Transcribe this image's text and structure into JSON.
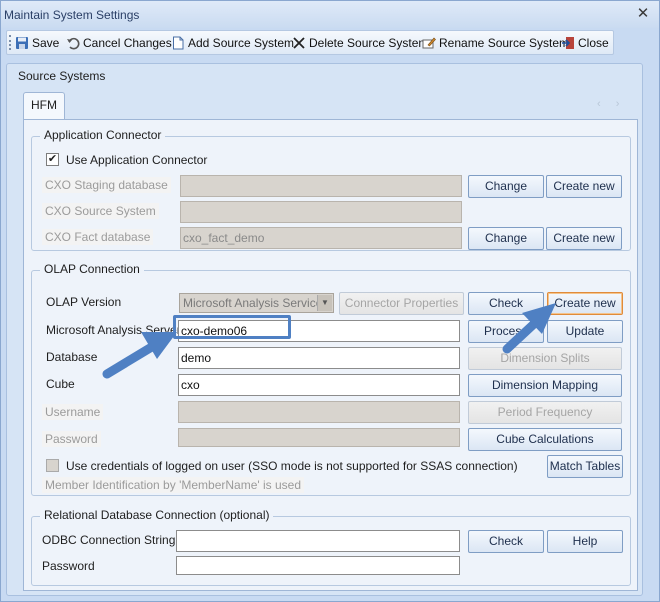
{
  "window": {
    "title": "Maintain System Settings",
    "close_glyph": "✕"
  },
  "toolbar": {
    "items": [
      {
        "label": "Save",
        "icon": "save-icon"
      },
      {
        "label": "Cancel Changes",
        "icon": "undo-icon"
      },
      {
        "label": "Add Source System",
        "icon": "new-document-icon"
      },
      {
        "label": "Delete Source System",
        "icon": "delete-icon"
      },
      {
        "label": "Rename Source System",
        "icon": "rename-icon"
      },
      {
        "label": "Close",
        "icon": "exit-icon"
      }
    ]
  },
  "source_systems": {
    "title": "Source Systems",
    "tabs": [
      {
        "label": "HFM",
        "selected": true
      }
    ],
    "tab_nav_glyph": "‹ ›"
  },
  "app_connector": {
    "title": "Application Connector",
    "use_connector": {
      "label": "Use Application Connector",
      "checked": true
    },
    "staging_db": {
      "label": "CXO Staging database",
      "value": "",
      "change": "Change",
      "create": "Create new"
    },
    "source_system": {
      "label": "CXO Source System",
      "value": ""
    },
    "fact_db": {
      "label": "CXO Fact database",
      "value": "cxo_fact_demo",
      "change": "Change",
      "create": "Create new"
    }
  },
  "olap": {
    "title": "OLAP Connection",
    "version": {
      "label": "OLAP Version",
      "selected": "Microsoft Analysis Services",
      "connector_props": "Connector Properties"
    },
    "check": "Check",
    "create_new": "Create new",
    "server": {
      "label": "Microsoft Analysis Server",
      "value": "cxo-demo06"
    },
    "database": {
      "label": "Database",
      "value": "demo"
    },
    "cube": {
      "label": "Cube",
      "value": "cxo"
    },
    "username": {
      "label": "Username",
      "value": ""
    },
    "password": {
      "label": "Password",
      "value": ""
    },
    "process": "Process",
    "update": "Update",
    "dimension_splits": "Dimension Splits",
    "dimension_mapping": "Dimension Mapping",
    "period_frequency": "Period Frequency",
    "cube_calculations": "Cube Calculations",
    "sso": {
      "label": "Use credentials of logged on user (SSO mode is not supported for SSAS connection)",
      "checked": false
    },
    "member_id": "Member Identification by 'MemberName' is used",
    "match_tables": "Match Tables"
  },
  "relational": {
    "title": "Relational Database Connection (optional)",
    "odbc": {
      "label": "ODBC Connection String",
      "value": ""
    },
    "password": {
      "label": "Password",
      "value": ""
    },
    "check": "Check",
    "help": "Help"
  },
  "colors": {
    "window_bg": "#c8daf2",
    "panel_bg": "#d6e4f5",
    "tab_body_bg": "#eef3fa",
    "annotation": "#4f80c3",
    "focus_border": "#e08b3a"
  }
}
